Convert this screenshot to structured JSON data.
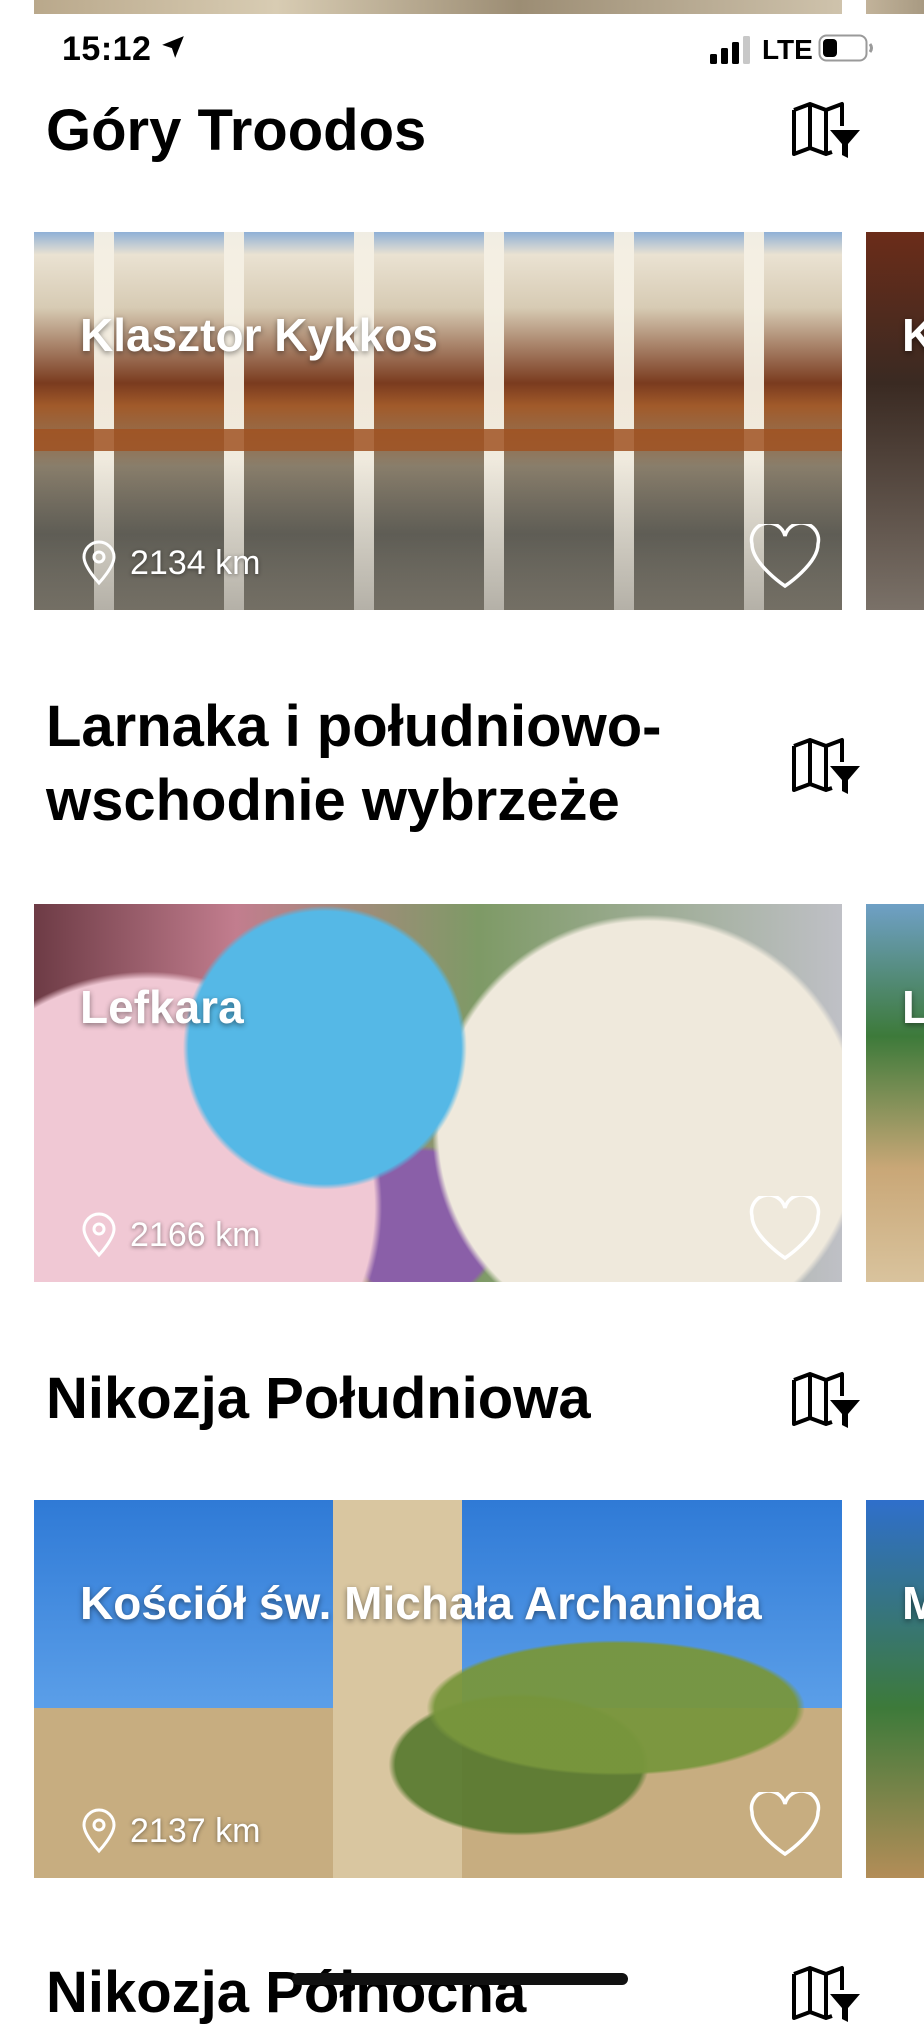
{
  "status_bar": {
    "time": "15:12",
    "network": "LTE"
  },
  "sections": [
    {
      "title": "Góry Troodos",
      "cards": [
        {
          "name": "Klasztor Kykkos",
          "distance": "2134 km"
        }
      ],
      "peek_initial": "K"
    },
    {
      "title": "Larnaka i południowo-wschodnie wybrzeże",
      "cards": [
        {
          "name": "Lefkara",
          "distance": "2166 km"
        }
      ],
      "peek_initial": "L"
    },
    {
      "title": "Nikozja Południowa",
      "cards": [
        {
          "name": "Kościół św. Michała Archanioła",
          "distance": "2137 km"
        }
      ],
      "peek_initial": "M"
    },
    {
      "title": "Nikozja Północna"
    }
  ],
  "icons": {
    "location_arrow": "location-arrow-icon",
    "map_filter": "map-filter-icon",
    "pin": "map-pin-icon",
    "heart": "heart-outline-icon"
  },
  "colors": {
    "text": "#000000",
    "background": "#ffffff",
    "overlay_text": "#ffffff"
  }
}
